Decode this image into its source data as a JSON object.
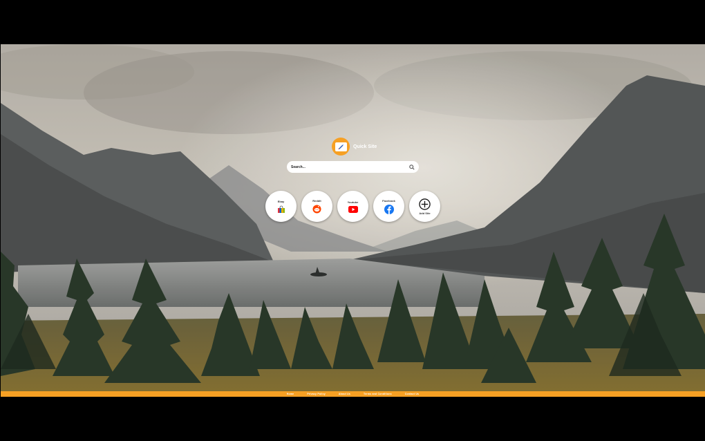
{
  "brand": {
    "name": "Quick Site",
    "accent": "#f6a024"
  },
  "search": {
    "placeholder": "Search..."
  },
  "shortcuts": [
    {
      "label": "Ebay",
      "icon": "shopping-bag-icon"
    },
    {
      "label": "Reddit",
      "icon": "reddit-icon"
    },
    {
      "label": "Youtube",
      "icon": "youtube-icon"
    },
    {
      "label": "Facebook",
      "icon": "facebook-icon"
    },
    {
      "label": "Add Site",
      "icon": "add-circle-icon"
    }
  ],
  "footer": {
    "links": [
      "Home",
      "Privacy Policy",
      "About Us",
      "Terms and Conditions",
      "Contact Us"
    ]
  }
}
